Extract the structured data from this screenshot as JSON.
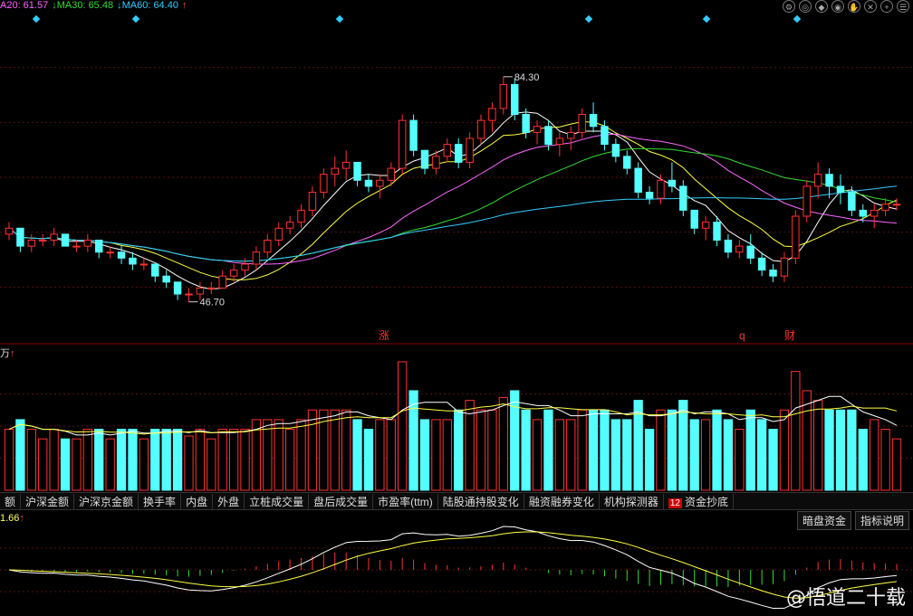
{
  "ma_legend": {
    "ma20": "A20: 61.57",
    "ma30": "MA30: 65.48",
    "ma60": "MA60: 64.40",
    "arrow_up": "↑",
    "arrow_down": "↓",
    "colors": {
      "ma20": "#ff66ff",
      "ma30": "#33dd33",
      "ma60": "#33ccff"
    }
  },
  "toolbar": {
    "icons": [
      "settings-icon",
      "zoom-icon",
      "pin-icon",
      "eye-icon",
      "hand-icon",
      "delete-icon",
      "plus-icon",
      "menu-icon"
    ]
  },
  "price_chart": {
    "high_label": "84.30",
    "low_label": "46.70",
    "event_markers": [
      "涨",
      "q",
      "财"
    ],
    "grid": true,
    "y_range": [
      40,
      95
    ]
  },
  "volume_panel": {
    "unit_label": "万",
    "arrow": "↑"
  },
  "tabs": {
    "items": [
      "额",
      "沪深金额",
      "沪深京金额",
      "换手率",
      "内盘",
      "外盘",
      "立桩成交量",
      "盘后成交量",
      "市盈率(ttm)",
      "陆股通持股变化",
      "融资融券变化",
      "机构探测器",
      "资金抄底"
    ],
    "badge": "12"
  },
  "indicator_panel": {
    "value_label": "1.66",
    "arrow": "↑",
    "buttons": [
      "暗盘资金",
      "指标说明"
    ]
  },
  "watermark": "@悟道二十载",
  "chart_data": {
    "type": "candlestick",
    "series": [
      {
        "name": "price",
        "values": [
          [
            58,
            60,
            57,
            59
          ],
          [
            59,
            59,
            55,
            56
          ],
          [
            56,
            58,
            55,
            57
          ],
          [
            57,
            58,
            56,
            57
          ],
          [
            57,
            59,
            56,
            58
          ],
          [
            58,
            58,
            56,
            56
          ],
          [
            56,
            57,
            55,
            56
          ],
          [
            56,
            58,
            55,
            57
          ],
          [
            57,
            57,
            54,
            55
          ],
          [
            55,
            56,
            54,
            55
          ],
          [
            55,
            56,
            53,
            54
          ],
          [
            54,
            55,
            52,
            53
          ],
          [
            53,
            54,
            52,
            53
          ],
          [
            53,
            53,
            50,
            51
          ],
          [
            51,
            52,
            49,
            50
          ],
          [
            50,
            50,
            47,
            48
          ],
          [
            48,
            49,
            46.7,
            48
          ],
          [
            48,
            50,
            47,
            49
          ],
          [
            49,
            50,
            48,
            49
          ],
          [
            49,
            52,
            49,
            51
          ],
          [
            51,
            53,
            50,
            52
          ],
          [
            52,
            54,
            51,
            53
          ],
          [
            53,
            56,
            52,
            55
          ],
          [
            55,
            58,
            54,
            57
          ],
          [
            57,
            60,
            56,
            59
          ],
          [
            59,
            61,
            58,
            60
          ],
          [
            60,
            63,
            59,
            62
          ],
          [
            62,
            66,
            61,
            65
          ],
          [
            65,
            69,
            64,
            68
          ],
          [
            68,
            71,
            66,
            69
          ],
          [
            69,
            72,
            67,
            70
          ],
          [
            70,
            70,
            66,
            67
          ],
          [
            67,
            68,
            65,
            66
          ],
          [
            66,
            68,
            64,
            67
          ],
          [
            67,
            70,
            66,
            69
          ],
          [
            69,
            78,
            68,
            77
          ],
          [
            77,
            78,
            71,
            72
          ],
          [
            72,
            72,
            68,
            69
          ],
          [
            69,
            72,
            68,
            71
          ],
          [
            71,
            74,
            70,
            73
          ],
          [
            73,
            74,
            69,
            70
          ],
          [
            70,
            75,
            69,
            74
          ],
          [
            74,
            78,
            73,
            77
          ],
          [
            77,
            80,
            75,
            79
          ],
          [
            79,
            84.3,
            78,
            83
          ],
          [
            83,
            84,
            77,
            78
          ],
          [
            78,
            79,
            74,
            75
          ],
          [
            75,
            77,
            73,
            76
          ],
          [
            76,
            77,
            72,
            73
          ],
          [
            73,
            75,
            71,
            74
          ],
          [
            74,
            76,
            72,
            75
          ],
          [
            75,
            79,
            74,
            78
          ],
          [
            78,
            80,
            75,
            76
          ],
          [
            76,
            77,
            72,
            73
          ],
          [
            73,
            74,
            70,
            71
          ],
          [
            71,
            72,
            68,
            69
          ],
          [
            69,
            70,
            64,
            65
          ],
          [
            65,
            66,
            63,
            64
          ],
          [
            64,
            68,
            63,
            67
          ],
          [
            67,
            70,
            65,
            66
          ],
          [
            66,
            67,
            61,
            62
          ],
          [
            62,
            62,
            58,
            59
          ],
          [
            59,
            61,
            57,
            60
          ],
          [
            60,
            61,
            56,
            57
          ],
          [
            57,
            58,
            54,
            55
          ],
          [
            55,
            57,
            54,
            56
          ],
          [
            56,
            58,
            53,
            54
          ],
          [
            54,
            55,
            51,
            52
          ],
          [
            52,
            53,
            50,
            51
          ],
          [
            51,
            55,
            50,
            54
          ],
          [
            54,
            62,
            53,
            61
          ],
          [
            61,
            67,
            60,
            66
          ],
          [
            66,
            70,
            64,
            68
          ],
          [
            68,
            69,
            64,
            66
          ],
          [
            66,
            68,
            63,
            65
          ],
          [
            65,
            66,
            61,
            62
          ],
          [
            62,
            63,
            60,
            61
          ],
          [
            61,
            63,
            59,
            62
          ],
          [
            62,
            64,
            61,
            63
          ],
          [
            63,
            64,
            62,
            63
          ]
        ]
      }
    ]
  }
}
